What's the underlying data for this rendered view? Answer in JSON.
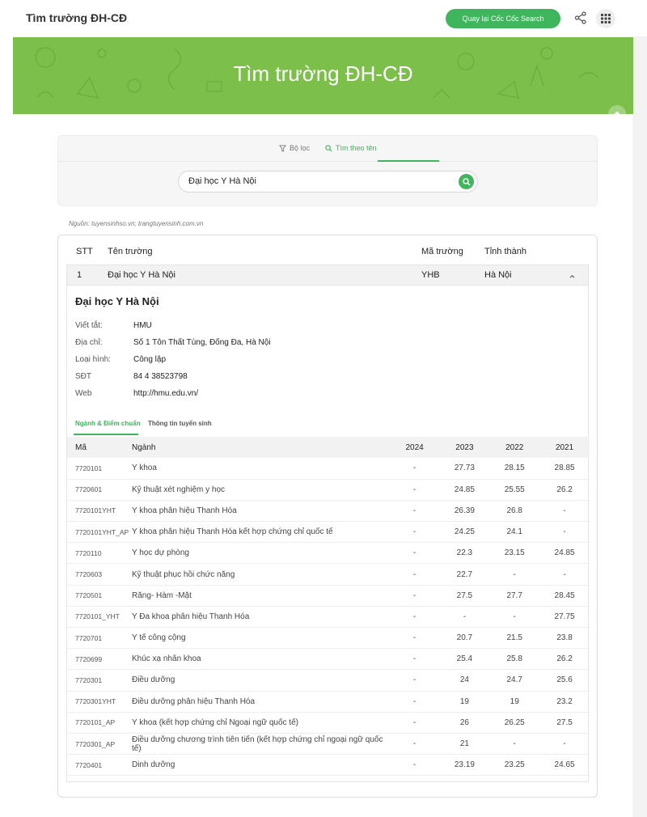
{
  "app": {
    "title": "Tìm trường ĐH-CĐ",
    "back_button": "Quay lại Cốc Cốc Search"
  },
  "banner": {
    "title": "Tìm trường ĐH-CĐ"
  },
  "search_tabs": {
    "filter": "Bộ lọc",
    "by_name": "Tìm theo tên"
  },
  "search": {
    "value": "Đại học Y Hà Nội"
  },
  "source": "Nguồn: tuyensinhso.vn; trangtuyensinh.com.vn",
  "results": {
    "headers": {
      "stt": "STT",
      "name": "Tên trường",
      "code": "Mã trường",
      "province": "Tỉnh thành"
    },
    "row": {
      "stt": "1",
      "name": "Đại học Y Hà Nội",
      "code": "YHB",
      "province": "Hà Nội"
    }
  },
  "detail": {
    "school_name": "Đại học Y Hà Nội",
    "info": [
      {
        "label": "Viết tắt:",
        "value": "HMU"
      },
      {
        "label": "Địa chỉ:",
        "value": "Số 1 Tôn Thất Tùng, Đống Đa, Hà Nội"
      },
      {
        "label": "Loại hình:",
        "value": "Công lập"
      },
      {
        "label": "SĐT",
        "value": "84 4 38523798"
      },
      {
        "label": "Web",
        "value": "http://hmu.edu.vn/"
      }
    ],
    "tabs": {
      "majors": "Ngành & Điểm chuẩn",
      "admission": "Thông tin tuyển sinh"
    }
  },
  "scores": {
    "headers": {
      "code": "Mã",
      "major": "Ngành",
      "y2024": "2024",
      "y2023": "2023",
      "y2022": "2022",
      "y2021": "2021"
    },
    "rows": [
      {
        "code": "7720101",
        "major": "Y khoa",
        "y2024": "-",
        "y2023": "27.73",
        "y2022": "28.15",
        "y2021": "28.85"
      },
      {
        "code": "7720601",
        "major": "Kỹ thuật xét nghiệm y học",
        "y2024": "-",
        "y2023": "24.85",
        "y2022": "25.55",
        "y2021": "26.2"
      },
      {
        "code": "7720101YHT",
        "major": "Y khoa phân hiệu Thanh Hóa",
        "y2024": "-",
        "y2023": "26.39",
        "y2022": "26.8",
        "y2021": "-"
      },
      {
        "code": "7720101YHT_AP",
        "major": "Y khoa phân hiệu Thanh Hóa kết hợp chứng chỉ quốc tế",
        "y2024": "-",
        "y2023": "24.25",
        "y2022": "24.1",
        "y2021": "-"
      },
      {
        "code": "7720110",
        "major": "Y học dự phòng",
        "y2024": "-",
        "y2023": "22.3",
        "y2022": "23.15",
        "y2021": "24.85"
      },
      {
        "code": "7720603",
        "major": "Kỹ thuật phục hồi chức năng",
        "y2024": "-",
        "y2023": "22.7",
        "y2022": "-",
        "y2021": "-"
      },
      {
        "code": "7720501",
        "major": "Răng- Hàm -Mặt",
        "y2024": "-",
        "y2023": "27.5",
        "y2022": "27.7",
        "y2021": "28.45"
      },
      {
        "code": "7720101_YHT",
        "major": "Y Đa khoa phân hiệu Thanh Hóa",
        "y2024": "-",
        "y2023": "-",
        "y2022": "-",
        "y2021": "27.75"
      },
      {
        "code": "7720701",
        "major": "Y tế công cộng",
        "y2024": "-",
        "y2023": "20.7",
        "y2022": "21.5",
        "y2021": "23.8"
      },
      {
        "code": "7720699",
        "major": "Khúc xạ nhãn khoa",
        "y2024": "-",
        "y2023": "25.4",
        "y2022": "25.8",
        "y2021": "26.2"
      },
      {
        "code": "7720301",
        "major": "Điều dưỡng",
        "y2024": "-",
        "y2023": "24",
        "y2022": "24.7",
        "y2021": "25.6"
      },
      {
        "code": "7720301YHT",
        "major": "Điều dưỡng phân hiệu Thanh Hóa",
        "y2024": "-",
        "y2023": "19",
        "y2022": "19",
        "y2021": "23.2"
      },
      {
        "code": "7720101_AP",
        "major": "Y khoa (kết hợp chứng chỉ Ngoại ngữ quốc tế)",
        "y2024": "-",
        "y2023": "26",
        "y2022": "26.25",
        "y2021": "27.5"
      },
      {
        "code": "7720301_AP",
        "major": "Điều dưỡng chương trình tiên tiến (kết hợp chứng chỉ ngoại ngữ quốc tế)",
        "y2024": "-",
        "y2023": "21",
        "y2022": "-",
        "y2021": "-"
      },
      {
        "code": "7720401",
        "major": "Dinh dưỡng",
        "y2024": "-",
        "y2023": "23.19",
        "y2022": "23.25",
        "y2021": "24.65"
      }
    ]
  }
}
